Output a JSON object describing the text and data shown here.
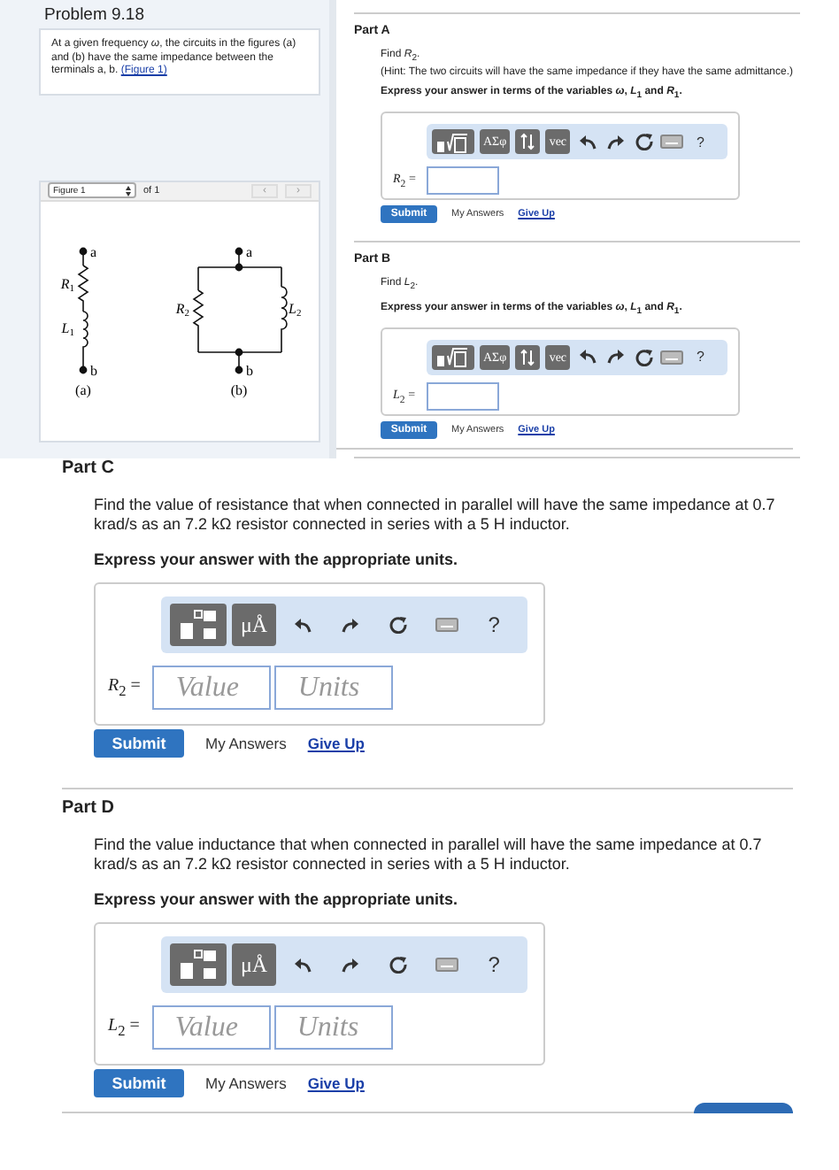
{
  "problem": {
    "title": "Problem 9.18",
    "text": "At a given frequency *ω*, the circuits in the figures (a) and (b) have the same impedance between the terminals a, b.",
    "figure_link": "(Figure 1)"
  },
  "figure": {
    "select": "Figure 1",
    "count": "of 1",
    "prev": "‹",
    "next": "›",
    "circuits": [
      {
        "kind": "series",
        "top": "a",
        "bottom": "b",
        "caption": "(a)",
        "elements": [
          {
            "kind": "resistor",
            "symbol": "R",
            "index": "1"
          },
          {
            "kind": "inductor",
            "symbol": "L",
            "index": "1"
          }
        ]
      },
      {
        "kind": "parallel",
        "top": "a",
        "bottom": "b",
        "caption": "(b)",
        "elements": [
          {
            "kind": "resistor",
            "symbol": "R",
            "index": "2"
          },
          {
            "kind": "inductor",
            "symbol": "L",
            "index": "2"
          }
        ]
      }
    ]
  },
  "side_parts": [
    {
      "kind": "symbolic",
      "title": "Part A",
      "prompt": "Find *R*$_{2}$.",
      "hint": "(Hint: The two circuits will have the same impedance if they have the same admittance.)",
      "instruction": "Express your answer in terms of the variables *ω*, *L*$_{1}$ and *R*$_{1}$.",
      "toolbar": [
        {
          "kind": "template"
        },
        {
          "kind": "text",
          "label": "ΑΣφ"
        },
        {
          "kind": "updown"
        },
        {
          "kind": "text",
          "label": "vec"
        },
        {
          "kind": "undo"
        },
        {
          "kind": "redo"
        },
        {
          "kind": "reset"
        },
        {
          "kind": "keyboard"
        },
        {
          "kind": "help",
          "label": "?"
        }
      ],
      "answer_label": "*R*$_{2}$ =",
      "submit": "Submit",
      "my_answers": "My Answers",
      "give_up": "Give Up"
    },
    {
      "kind": "symbolic",
      "title": "Part B",
      "prompt": "Find *L*$_{2}$.",
      "instruction": "Express your answer in terms of the variables *ω*, *L*$_{1}$ and *R*$_{1}$.",
      "toolbar": [
        {
          "kind": "template"
        },
        {
          "kind": "text",
          "label": "ΑΣφ"
        },
        {
          "kind": "updown"
        },
        {
          "kind": "text",
          "label": "vec"
        },
        {
          "kind": "undo"
        },
        {
          "kind": "redo"
        },
        {
          "kind": "reset"
        },
        {
          "kind": "keyboard"
        },
        {
          "kind": "help",
          "label": "?"
        }
      ],
      "answer_label": "*L*$_{2}$ =",
      "submit": "Submit",
      "my_answers": "My Answers",
      "give_up": "Give Up"
    }
  ],
  "parts": [
    {
      "kind": "units",
      "title": "Part C",
      "prompt": "Find the value of resistance that when connected in parallel will have the same impedance at 0.7 krad/s as an 7.2 kΩ resistor connected in series with a 5 H inductor.",
      "instruction": "Express your answer with the appropriate units.",
      "toolbar": [
        {
          "kind": "template"
        },
        {
          "kind": "text",
          "label": "μÅ"
        },
        {
          "kind": "undo"
        },
        {
          "kind": "redo"
        },
        {
          "kind": "reset"
        },
        {
          "kind": "keyboard"
        },
        {
          "kind": "help",
          "label": "?"
        }
      ],
      "answer_label": "*R*$_{2}$ =",
      "value_placeholder": "Value",
      "units_placeholder": "Units",
      "submit": "Submit",
      "my_answers": "My Answers",
      "give_up": "Give Up"
    },
    {
      "kind": "units",
      "title": "Part D",
      "prompt": "Find the value inductance that when connected in parallel will have the same impedance at 0.7 krad/s as an 7.2 kΩ resistor connected in series with a 5 H inductor.",
      "instruction": "Express your answer with the appropriate units.",
      "toolbar": [
        {
          "kind": "template"
        },
        {
          "kind": "text",
          "label": "μÅ"
        },
        {
          "kind": "undo"
        },
        {
          "kind": "redo"
        },
        {
          "kind": "reset"
        },
        {
          "kind": "keyboard"
        },
        {
          "kind": "help",
          "label": "?"
        }
      ],
      "answer_label": "*L*$_{2}$ =",
      "value_placeholder": "Value",
      "units_placeholder": "Units",
      "submit": "Submit",
      "my_answers": "My Answers",
      "give_up": "Give Up"
    }
  ]
}
